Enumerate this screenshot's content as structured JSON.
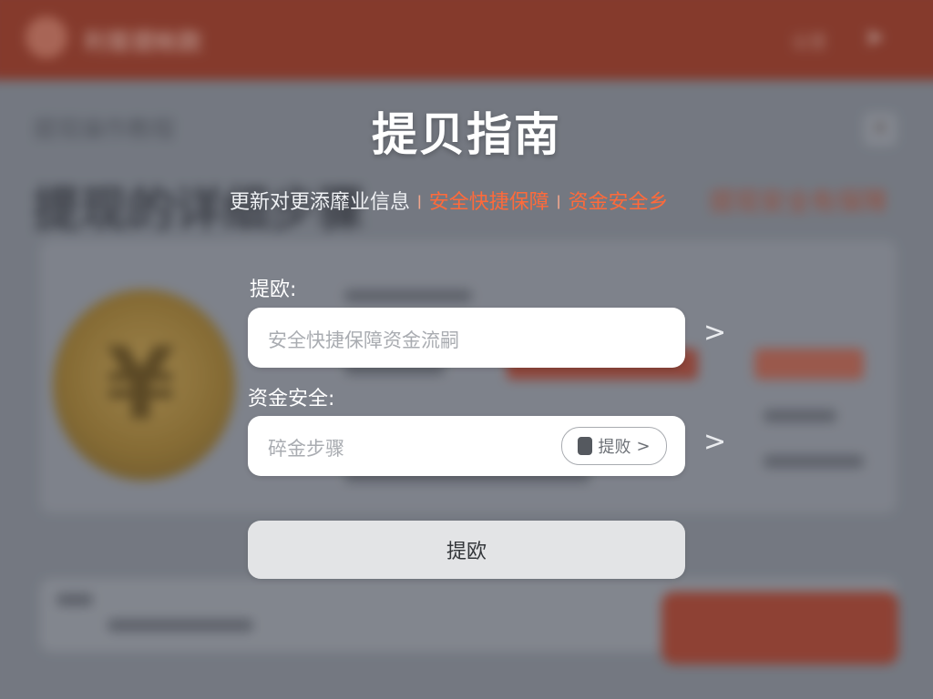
{
  "background": {
    "header_title": "利客提帐款",
    "header_right": "设置",
    "breadcrumb": "提现操作教程",
    "big_title": "提现的详细步骤",
    "orange_text": "提现安全有保障"
  },
  "guide": {
    "title": "提贝指南",
    "subtitle": {
      "part1": "更新对更添靡业信息",
      "separator": "ǀ",
      "part2": "安全快捷保障",
      "part3": "资金安全乡"
    },
    "field1": {
      "label": "提欧:",
      "placeholder": "安全快捷保障资金流嗣"
    },
    "field2": {
      "label": "资金安全:",
      "placeholder": "碎金步骤",
      "chip_label": "提败",
      "chip_arrow": ">"
    },
    "chevron": ">",
    "submit_label": "提欧"
  },
  "colors": {
    "accent_orange": "#ff6a3a",
    "header_red": "#a63a22"
  }
}
